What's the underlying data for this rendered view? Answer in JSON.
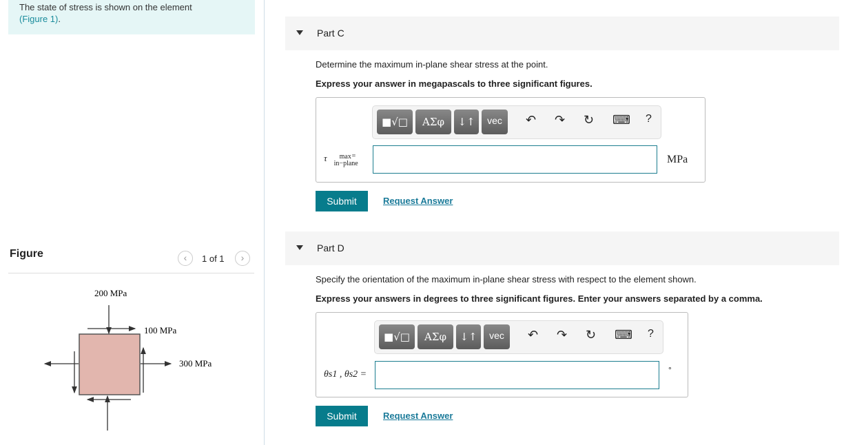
{
  "intro": {
    "text": "The state of stress is shown on the element",
    "figure_link": "(Figure 1)",
    "suffix": "."
  },
  "figure": {
    "title": "Figure",
    "pager": "1 of 1",
    "labels": {
      "top": "200 MPa",
      "shear": "100 MPa",
      "right": "300 MPa"
    },
    "element_color": "#e2b6ae"
  },
  "parts": [
    {
      "title": "Part C",
      "question": "Determine the maximum in-plane shear stress at the point.",
      "instruction": "Express your answer in megapascals to three significant figures.",
      "label_main": "τ",
      "label_sup": "max",
      "label_sub": "in−plane",
      "eq": "=",
      "unit": "MPa",
      "submit": "Submit",
      "request": "Request Answer"
    },
    {
      "title": "Part D",
      "question": "Specify the orientation of the maximum in-plane shear stress with respect to the element shown.",
      "instruction": "Express your answers in degrees to three significant figures. Enter your answers separated by a comma.",
      "label": "θs1 , θs2 =",
      "unit": "°",
      "submit": "Submit",
      "request": "Request Answer"
    }
  ],
  "toolbar": {
    "templates": "■√□",
    "greek": "ΑΣφ",
    "arrows": "↓↑",
    "vec": "vec",
    "undo": "↶",
    "redo": "↷",
    "reset": "↻",
    "keyboard": "⌨",
    "help": "?"
  }
}
